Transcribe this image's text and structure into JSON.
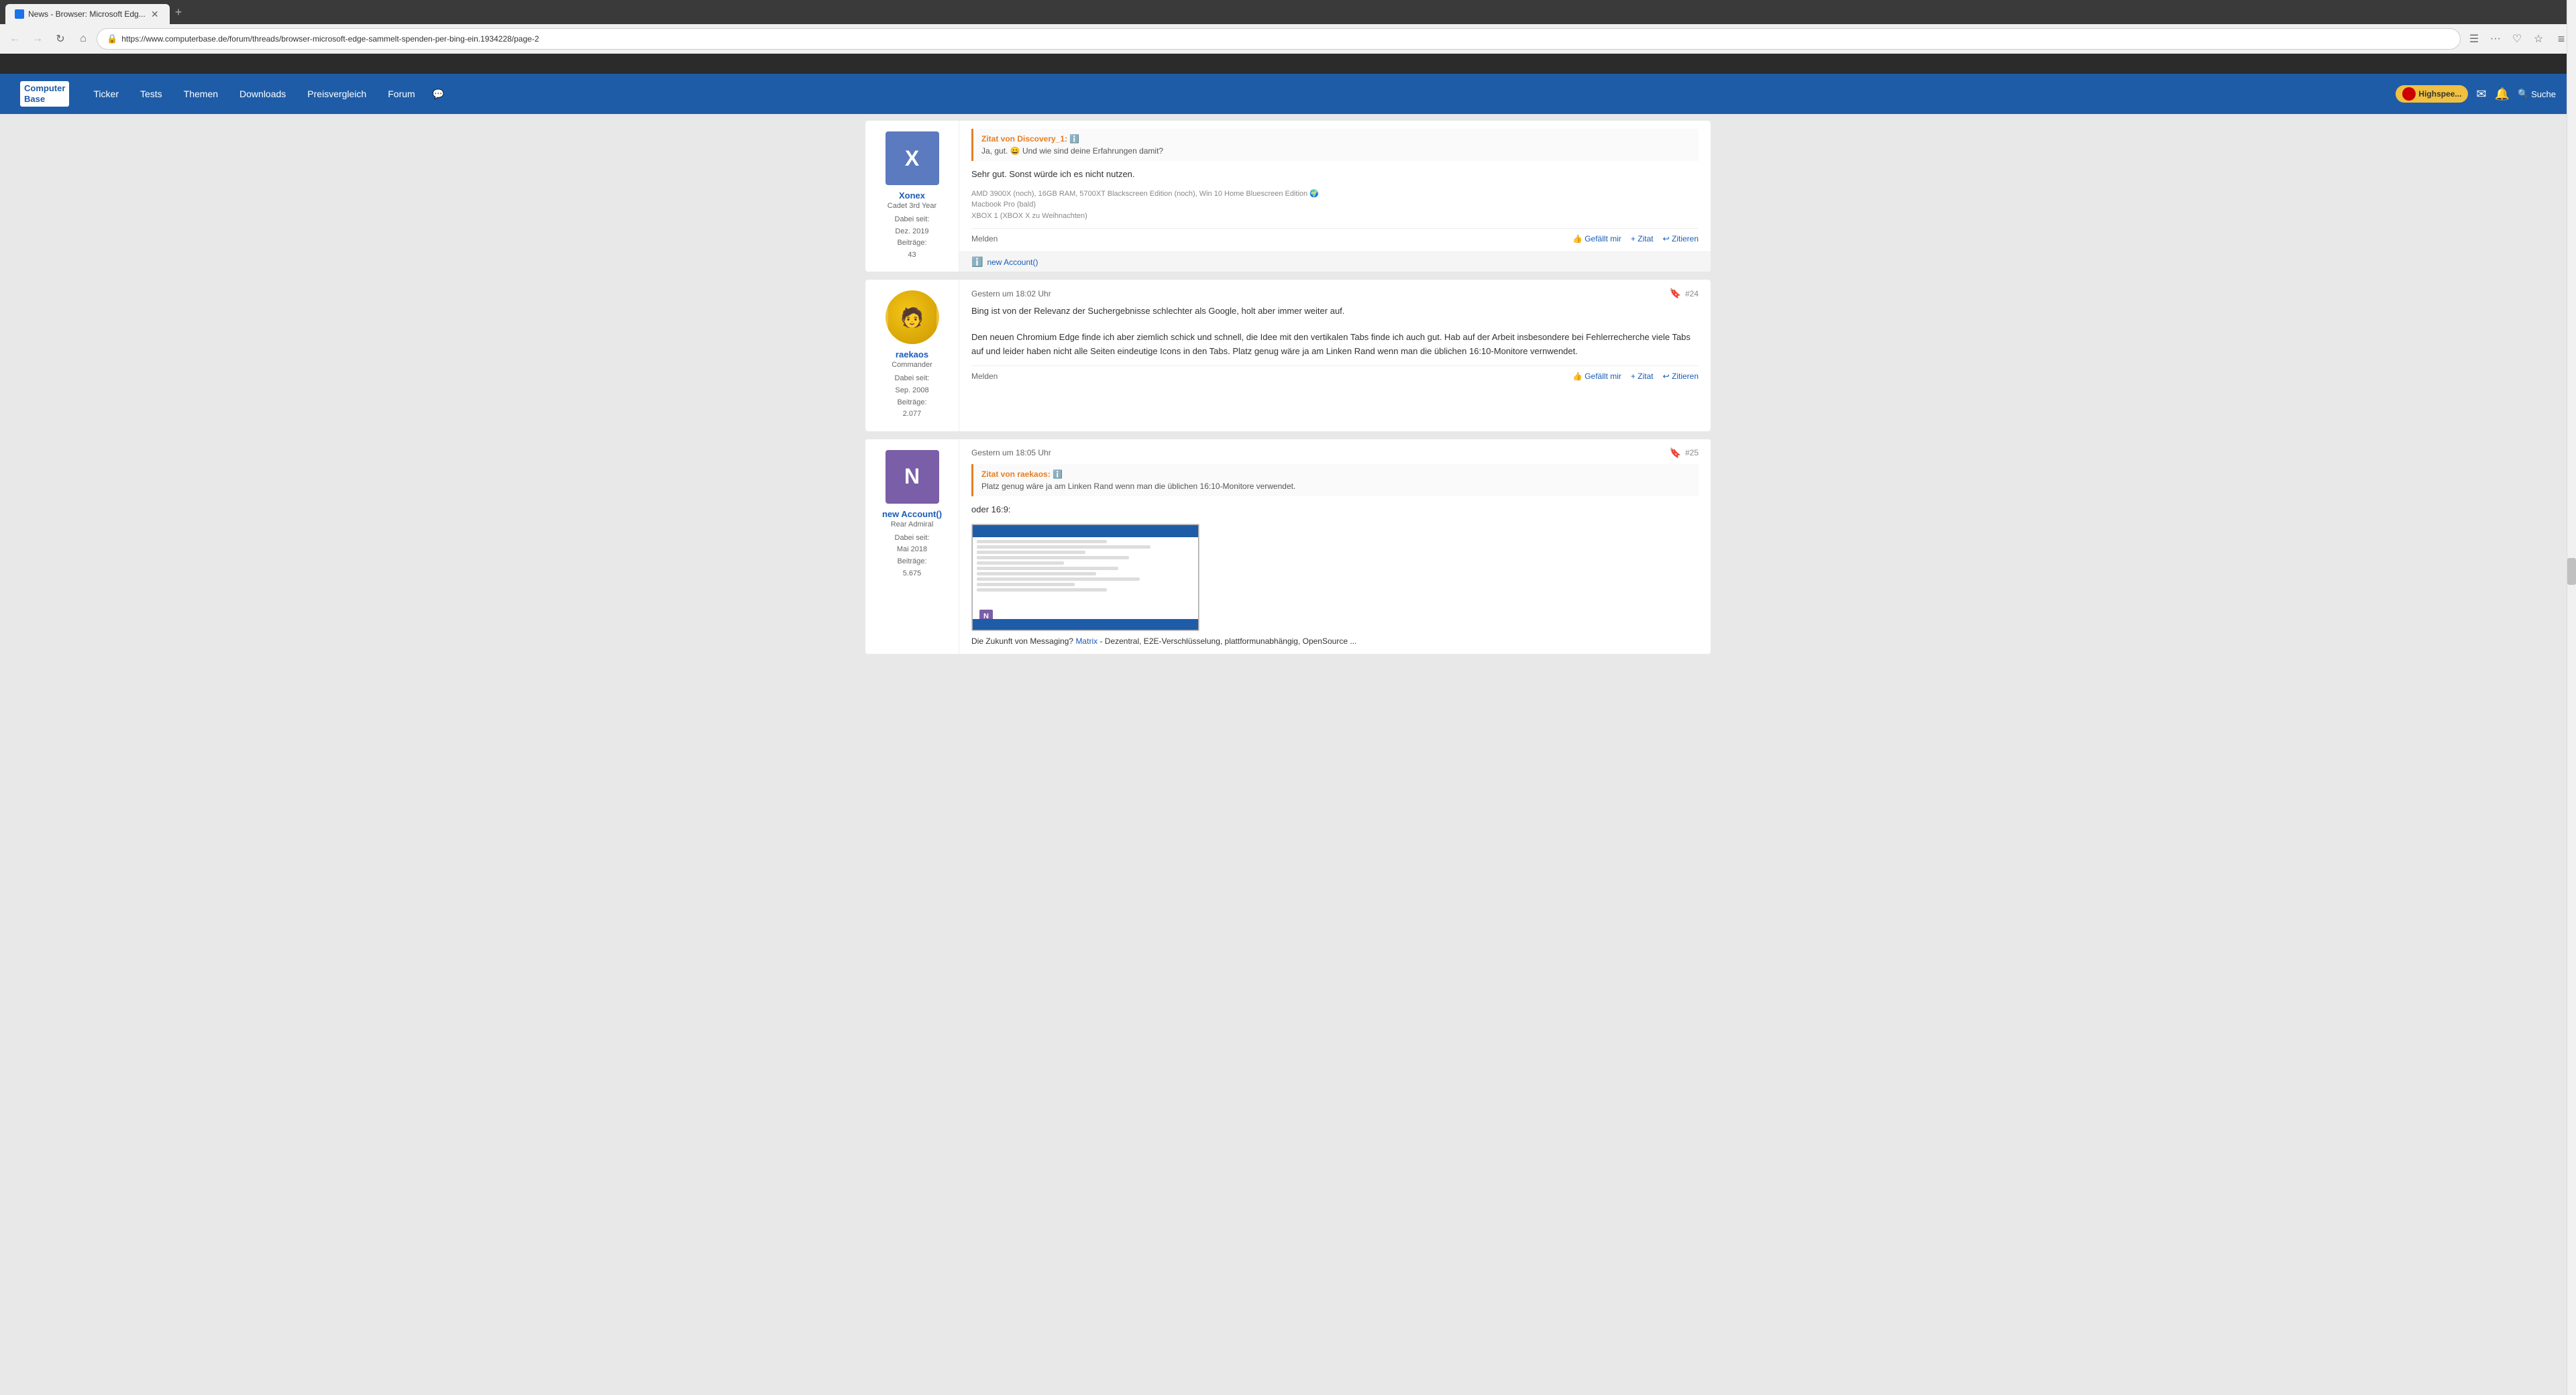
{
  "browser": {
    "tab_title": "News - Browser: Microsoft Edg...",
    "url": "https://www.computerbase.de/forum/threads/browser-microsoft-edge-sammelt-spenden-per-bing-ein.1934228/page-2",
    "back_enabled": true,
    "forward_enabled": false
  },
  "site": {
    "logo_line1": "Computer",
    "logo_line2": "Base",
    "nav_items": [
      "Ticker",
      "Tests",
      "Themen",
      "Downloads",
      "Preisvergleich",
      "Forum"
    ],
    "highspeed_label": "Highspee...",
    "search_label": "Suche"
  },
  "posts": [
    {
      "id": "post-xonex",
      "author": {
        "name": "Xonex",
        "rank": "Cadet 3rd Year",
        "joined_label": "Dabei seit:",
        "joined": "Dez. 2019",
        "posts_label": "Beiträge:",
        "posts": "43",
        "avatar_letter": "X",
        "avatar_color": "#5b7abf"
      },
      "quote": {
        "author_prefix": "Zitat von Discovery_1:",
        "text": "Ja, gut. 😄 Und wie sind deine Erfahrungen damit?"
      },
      "text": "Sehr gut. Sonst würde ich es nicht nutzen.",
      "sig": "AMD 3900X (noch), 16GB RAM, 5700XT Blackscreen Edition (noch), Win 10 Home Bluescreen Edition 🌍\nMacbook Pro (bald)\nXBOX 1 (XBOX X zu Weihnachten)",
      "actions": {
        "report": "Melden",
        "like": "Gefällt mir",
        "quote": "+ Zitat",
        "cite": "↩ Zitieren"
      },
      "reaction": "new Account()",
      "has_reaction": true
    },
    {
      "id": "post-raekaos",
      "num": "#24",
      "time": "Gestern um 18:02 Uhr",
      "author": {
        "name": "raekaos",
        "rank": "Commander",
        "joined_label": "Dabei seit:",
        "joined": "Sep. 2008",
        "posts_label": "Beiträge:",
        "posts": "2.077",
        "avatar_type": "image",
        "avatar_color": "#f0c040"
      },
      "text1": "Bing ist von der Relevanz der Suchergebnisse schlechter als Google, holt aber immer weiter auf.",
      "text2": "Den neuen Chromium Edge finde ich aber ziemlich schick und schnell, die Idee mit den vertikalen Tabs finde ich auch gut. Hab auf der Arbeit insbesondere bei Fehlerrecherche viele Tabs auf und leider haben nicht alle Seiten eindeutige Icons in den Tabs. Platz genug wäre ja am Linken Rand wenn man die üblichen 16:10-Monitore vernwendet.",
      "actions": {
        "report": "Melden",
        "like": "Gefällt mir",
        "quote": "+ Zitat",
        "cite": "↩ Zitieren"
      }
    },
    {
      "id": "post-newaccount",
      "num": "#25",
      "time": "Gestern um 18:05 Uhr",
      "author": {
        "name": "new Account()",
        "rank": "Rear Admiral",
        "joined_label": "Dabei seit:",
        "joined": "Mai 2018",
        "posts_label": "Beiträge:",
        "posts": "5.675",
        "avatar_letter": "N",
        "avatar_color": "#7b5ea8"
      },
      "quote": {
        "author_prefix": "Zitat von raekaos:",
        "text": "Platz genug wäre ja am Linken Rand wenn man die üblichen 16:10-Monitore verwendet."
      },
      "text_prefix": "oder 16:9:",
      "has_screenshot": true,
      "footer_text": "Die Zukunft von Messaging?",
      "footer_link": "Matrix",
      "footer_suffix": "- Dezentral, E2E-Verschlüsselung, plattformunabhängig, OpenSource ..."
    }
  ]
}
